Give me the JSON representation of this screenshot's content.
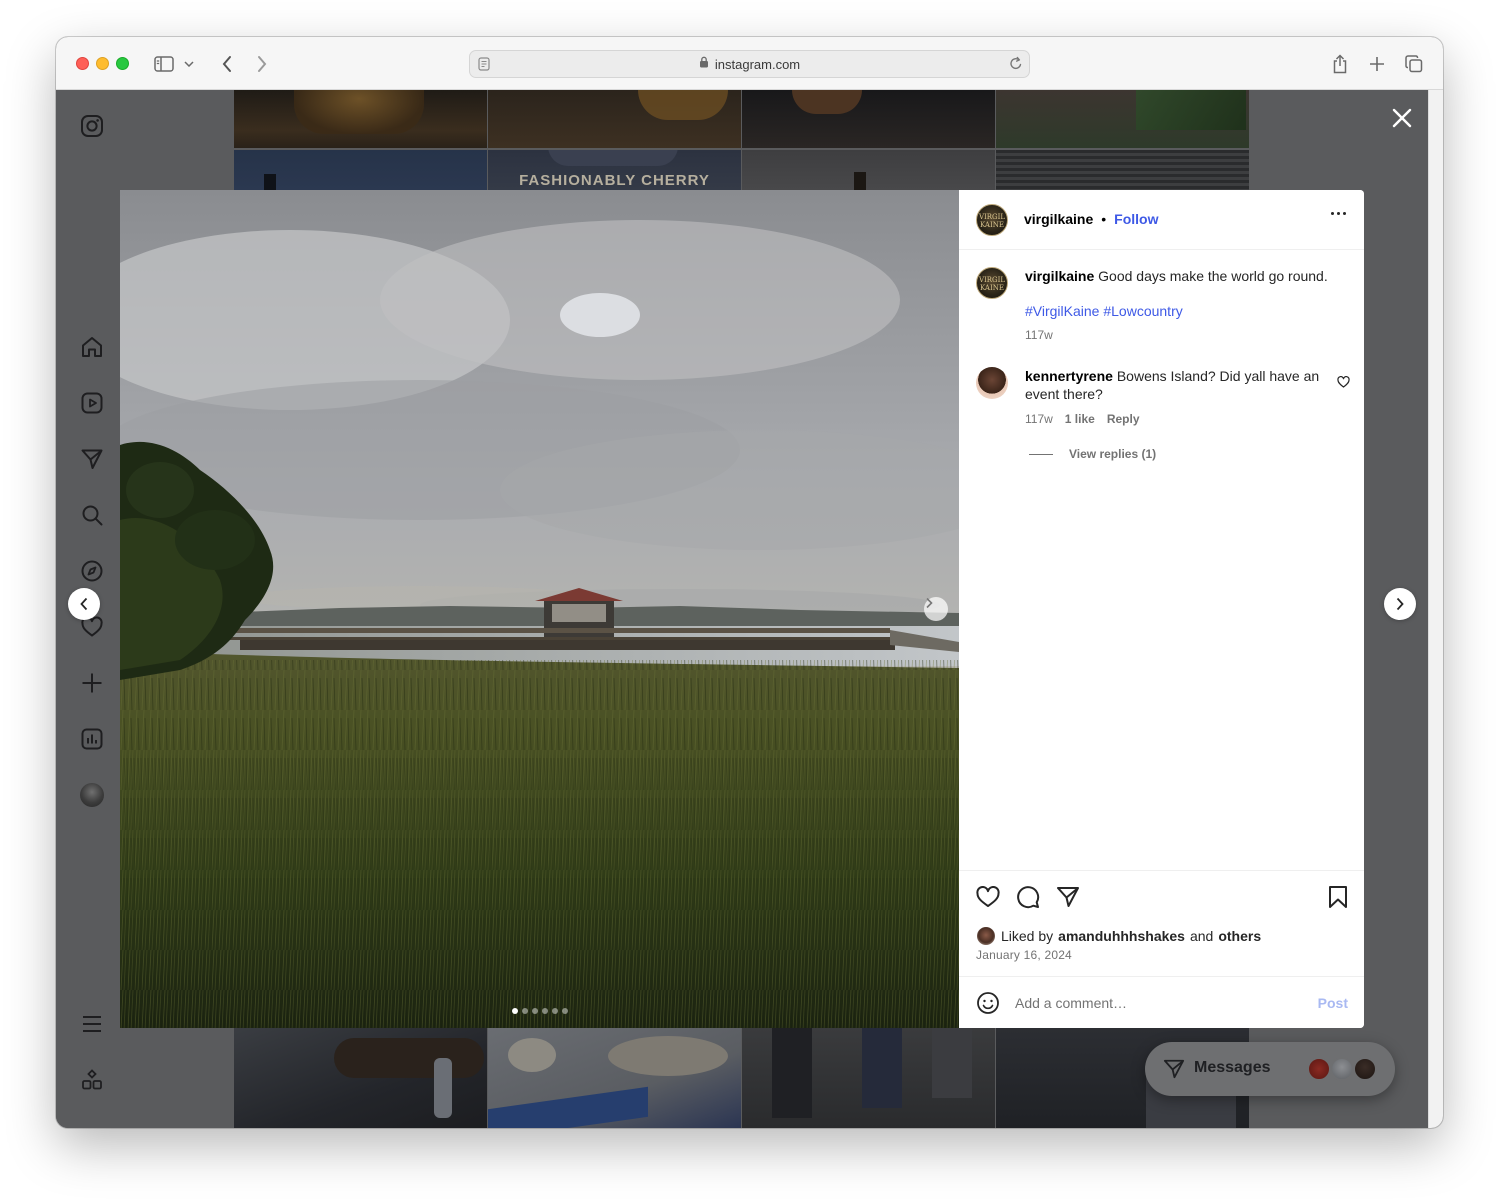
{
  "browser": {
    "url": "instagram.com"
  },
  "background_tiles": {
    "banner_text": "FASHIONABLY CHERRY"
  },
  "post": {
    "author": "virgilkaine",
    "follow_label": "Follow",
    "separator": "•",
    "avatar_text": "VIRGIL KAINE",
    "caption_text": "Good days make the world go round.",
    "hashtags": "#VirgilKaine #Lowcountry",
    "caption_age": "117w",
    "carousel": {
      "count": 6,
      "active_index": 0
    },
    "comments": [
      {
        "user": "kennertyrene",
        "text": "Bowens Island? Did yall have an event there?",
        "age": "117w",
        "likes": "1 like",
        "reply_label": "Reply",
        "view_replies": "View replies (1)"
      }
    ],
    "liked_by_prefix": "Liked by",
    "liked_by_user": "amanduhhhshakes",
    "liked_by_and": "and",
    "liked_by_others": "others",
    "date": "January 16, 2024",
    "comment_placeholder": "Add a comment…",
    "post_button": "Post"
  },
  "messages": {
    "label": "Messages"
  },
  "icons": {
    "sidebar": [
      "instagram-logo-icon",
      "home-icon",
      "reels-icon",
      "direct-icon",
      "search-icon",
      "explore-icon",
      "heart-icon",
      "create-icon",
      "insights-icon",
      "profile-icon",
      "menu-icon",
      "more-apps-icon"
    ],
    "actions": [
      "like-icon",
      "comment-icon",
      "share-icon",
      "save-icon"
    ]
  },
  "colors": {
    "link_blue": "#3e59e6",
    "post_disabled": "#a9b9f2",
    "overlay": "#5a5b5d"
  }
}
